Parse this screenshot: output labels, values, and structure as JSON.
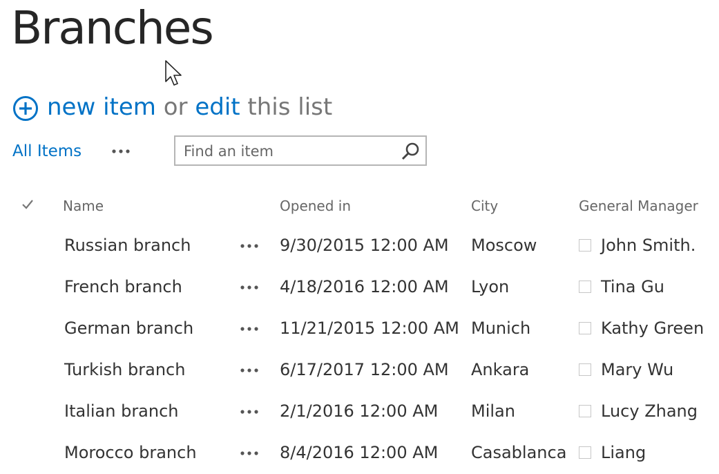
{
  "page": {
    "title": "Branches"
  },
  "command_bar": {
    "new_item_label": "new item",
    "or_label": "or",
    "edit_label": "edit",
    "this_list_label": "this list"
  },
  "view": {
    "current_view_label": "All Items",
    "search_placeholder": "Find an item"
  },
  "table": {
    "headers": {
      "name": "Name",
      "opened_in": "Opened in",
      "city": "City",
      "general_manager": "General Manager"
    },
    "rows": [
      {
        "name": "Russian branch",
        "opened_in": "9/30/2015 12:00 AM",
        "city": "Moscow",
        "general_manager": "John Smith."
      },
      {
        "name": "French branch",
        "opened_in": "4/18/2016 12:00 AM",
        "city": "Lyon",
        "general_manager": "Tina Gu"
      },
      {
        "name": "German branch",
        "opened_in": "11/21/2015 12:00 AM",
        "city": "Munich",
        "general_manager": "Kathy Green"
      },
      {
        "name": "Turkish branch",
        "opened_in": "6/17/2017 12:00 AM",
        "city": "Ankara",
        "general_manager": "Mary Wu"
      },
      {
        "name": "Italian branch",
        "opened_in": "2/1/2016 12:00 AM",
        "city": "Milan",
        "general_manager": "Lucy Zhang"
      },
      {
        "name": "Morocco branch",
        "opened_in": "8/4/2016 12:00 AM",
        "city": "Casablanca",
        "general_manager": "Liang"
      }
    ]
  },
  "icons": {
    "add": "plus-circle-icon",
    "more": "ellipsis-icon",
    "search": "search-icon",
    "select_all": "checkmark-icon",
    "presence": "presence-square-icon",
    "cursor": "mouse-pointer-icon"
  },
  "colors": {
    "link": "#0072c6",
    "muted_text": "#777777",
    "body_text": "#333333",
    "title_text": "#262626",
    "search_border": "#b5b5b5"
  }
}
